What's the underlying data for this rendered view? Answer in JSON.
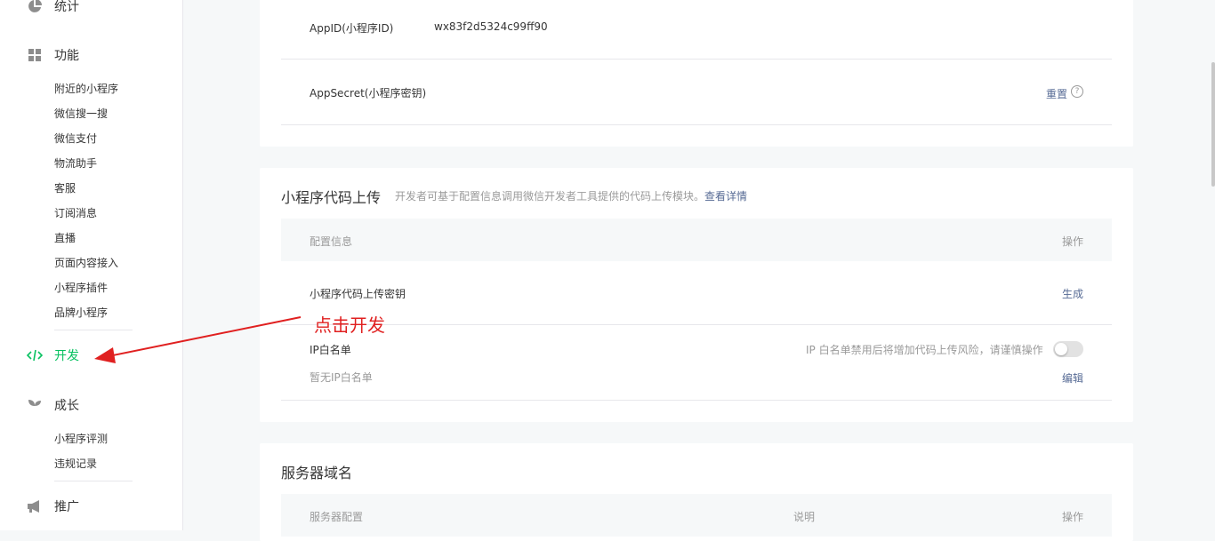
{
  "sidebar": {
    "cat_stats": "统计",
    "cat_features": "功能",
    "features": [
      "附近的小程序",
      "微信搜一搜",
      "微信支付",
      "物流助手",
      "客服",
      "订阅消息",
      "直播",
      "页面内容接入",
      "小程序插件",
      "品牌小程序"
    ],
    "cat_dev": "开发",
    "cat_growth": "成长",
    "growth": [
      "小程序评测",
      "违规记录"
    ],
    "cat_promo": "推广"
  },
  "account": {
    "appid_label": "AppID(小程序ID)",
    "appid_value": "wx83f2d5324c99ff90",
    "secret_label": "AppSecret(小程序密钥)",
    "reset_label": "重置",
    "help_symbol": "?"
  },
  "upload": {
    "title": "小程序代码上传",
    "desc": "开发者可基于配置信息调用微信开发者工具提供的代码上传模块。",
    "detail_link": "查看详情",
    "col_config": "配置信息",
    "col_action": "操作",
    "key_label": "小程序代码上传密钥",
    "generate_label": "生成",
    "ip_label": "IP白名单",
    "ip_warning": "IP 白名单禁用后将增加代码上传风险，请谨慎操作",
    "ip_empty": "暂无IP白名单",
    "edit_label": "编辑",
    "ip_toggle_on": false
  },
  "server": {
    "title": "服务器域名",
    "col_config": "服务器配置",
    "col_desc": "说明",
    "col_action": "操作"
  },
  "annotation": {
    "text": "点击开发",
    "color": "#e02020"
  },
  "colors": {
    "active": "#07c160",
    "link": "#576b95"
  }
}
